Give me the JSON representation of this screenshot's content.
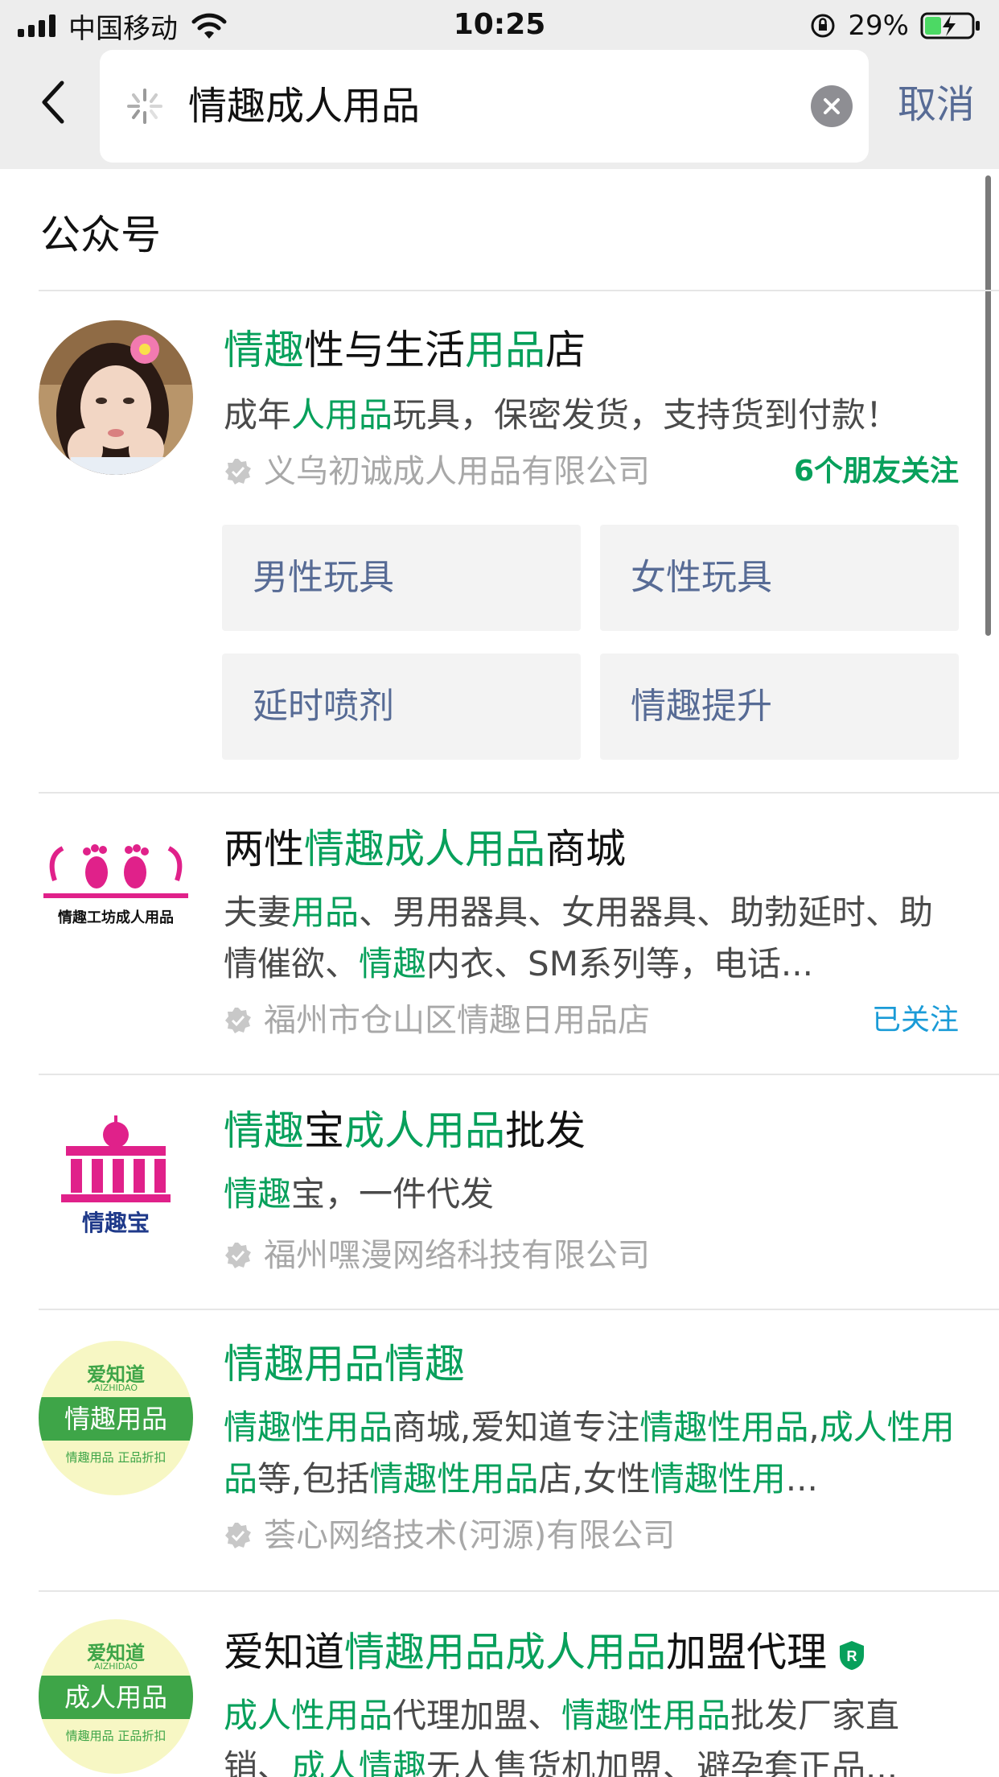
{
  "status_bar": {
    "carrier": "中国移动",
    "time": "10:25",
    "battery": "29%"
  },
  "search": {
    "query": "情趣成人用品",
    "cancel_label": "取消"
  },
  "section": {
    "title": "公众号"
  },
  "results": [
    {
      "title_parts": [
        {
          "text": "情趣",
          "hl": true
        },
        {
          "text": "性与生活",
          "hl": false
        },
        {
          "text": "用品",
          "hl": true
        },
        {
          "text": "店",
          "hl": false
        }
      ],
      "desc_parts": [
        {
          "text": "成年",
          "hl": false
        },
        {
          "text": "人用品",
          "hl": true
        },
        {
          "text": "玩具，保密发货，支持货到付款！",
          "hl": false
        }
      ],
      "org": "义乌初诚成人用品有限公司",
      "follow": "6个朋友关注",
      "menu": [
        "男性玩具",
        "女性玩具",
        "延时喷剂",
        "情趣提升"
      ]
    },
    {
      "title_parts": [
        {
          "text": "两性",
          "hl": false
        },
        {
          "text": "情趣成人用品",
          "hl": true
        },
        {
          "text": "商城",
          "hl": false
        }
      ],
      "desc_parts": [
        {
          "text": "夫妻",
          "hl": false
        },
        {
          "text": "用品",
          "hl": true
        },
        {
          "text": "、男用器具、女用器具、助勃延时、助情催欲、",
          "hl": false
        },
        {
          "text": "情趣",
          "hl": true
        },
        {
          "text": "内衣、SM系列等，电话...",
          "hl": false
        }
      ],
      "org": "福州市仓山区情趣日用品店",
      "follow": "已关注",
      "logo_text": "情趣工坊成人用品"
    },
    {
      "title_parts": [
        {
          "text": "情趣",
          "hl": true
        },
        {
          "text": "宝",
          "hl": false
        },
        {
          "text": "成人用品",
          "hl": true
        },
        {
          "text": "批发",
          "hl": false
        }
      ],
      "desc_parts": [
        {
          "text": "情趣",
          "hl": true
        },
        {
          "text": "宝，一件代发",
          "hl": false
        }
      ],
      "org": "福州嘿漫网络科技有限公司",
      "logo_text": "情趣宝"
    },
    {
      "title_parts": [
        {
          "text": "情趣用品情趣",
          "hl": true
        }
      ],
      "desc_parts": [
        {
          "text": "情趣性用品",
          "hl": true
        },
        {
          "text": "商城,爱知道专注",
          "hl": false
        },
        {
          "text": "情趣性用品",
          "hl": true
        },
        {
          "text": ",",
          "hl": false
        },
        {
          "text": "成人性用品",
          "hl": true
        },
        {
          "text": "等,包括",
          "hl": false
        },
        {
          "text": "情趣性用品",
          "hl": true
        },
        {
          "text": "店,女性",
          "hl": false
        },
        {
          "text": "情趣性用",
          "hl": true
        },
        {
          "text": "...",
          "hl": false
        }
      ],
      "org": "荟心网络技术(河源)有限公司",
      "logo_brand": "爱知道",
      "logo_sub": "AIZHIDAO",
      "logo_main": "情趣用品",
      "logo_foot": "情趣用品 正品折扣"
    },
    {
      "title_parts": [
        {
          "text": "爱知道",
          "hl": false
        },
        {
          "text": "情趣用品成人用品",
          "hl": true
        },
        {
          "text": "加盟代理",
          "hl": false
        }
      ],
      "desc_parts": [
        {
          "text": "成人性用品",
          "hl": true
        },
        {
          "text": "代理加盟、",
          "hl": false
        },
        {
          "text": "情趣性用品",
          "hl": true
        },
        {
          "text": "批发厂家直销、",
          "hl": false
        },
        {
          "text": "成人情趣",
          "hl": true
        },
        {
          "text": "无人售货机加盟、避孕套正品...",
          "hl": false
        }
      ],
      "badge": "R",
      "logo_brand": "爱知道",
      "logo_sub": "AIZHIDAO",
      "logo_main": "成人用品",
      "logo_foot": "情趣用品 正品折扣"
    }
  ],
  "colors": {
    "highlight": "#07a05b",
    "link": "#576b95",
    "followed": "#1a9bd7",
    "logo_pink": "#e0218a",
    "logo_green": "#3ea548"
  }
}
